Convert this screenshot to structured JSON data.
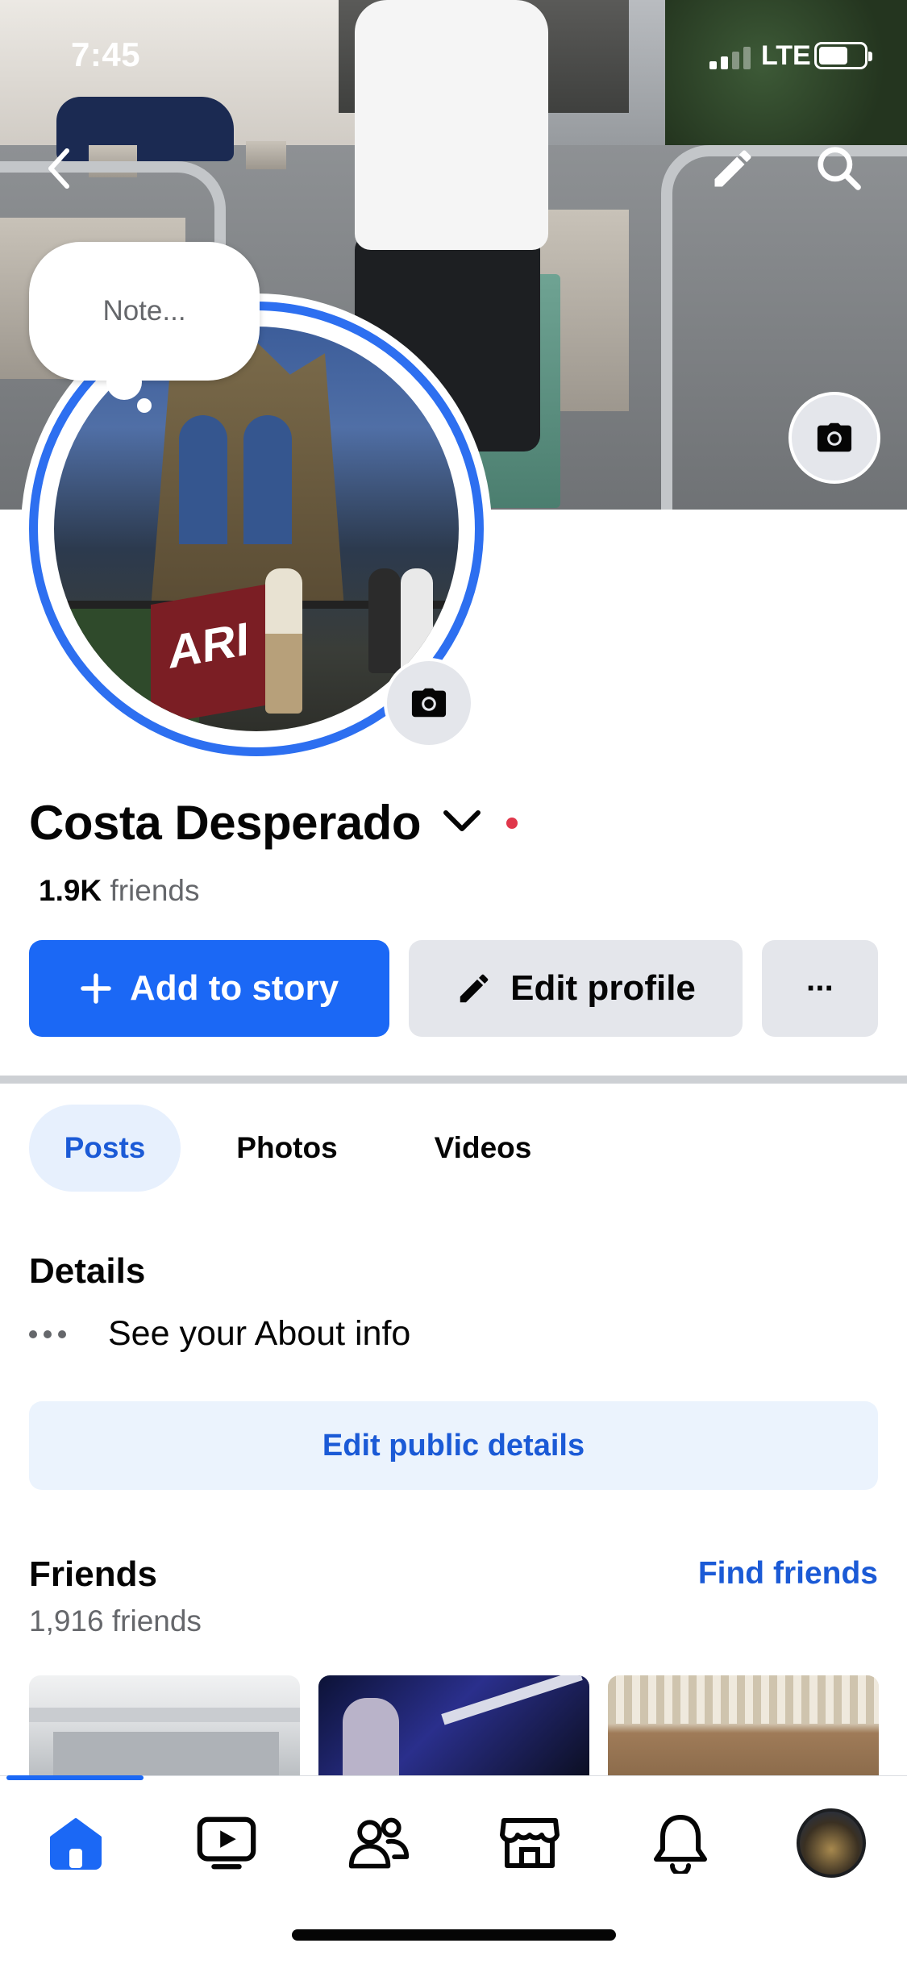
{
  "status_bar": {
    "time": "7:45",
    "network": "LTE",
    "battery_level": 0.65
  },
  "cover": {
    "note_placeholder": "Note..."
  },
  "profile": {
    "name": "Costa Desperado",
    "friends_count": "1.9K",
    "friends_suffix": "friends",
    "online_dot_color": "#e0374b",
    "avatar_banner_text": "ARI"
  },
  "actions": {
    "add_story_label": "Add to story",
    "edit_profile_label": "Edit profile",
    "more_label": "···"
  },
  "tabs": [
    {
      "label": "Posts",
      "active": true
    },
    {
      "label": "Photos",
      "active": false
    },
    {
      "label": "Videos",
      "active": false
    }
  ],
  "details": {
    "title": "Details",
    "about_text": "See your About info",
    "edit_button": "Edit public details"
  },
  "friends": {
    "title": "Friends",
    "find_link": "Find friends",
    "count_text": "1,916 friends"
  },
  "bottom_nav": [
    {
      "name": "home-icon",
      "active": true
    },
    {
      "name": "video-icon",
      "active": false
    },
    {
      "name": "friends-icon",
      "active": false
    },
    {
      "name": "marketplace-icon",
      "active": false
    },
    {
      "name": "bell-icon",
      "active": false
    },
    {
      "name": "profile-avatar",
      "active": false
    }
  ],
  "colors": {
    "accent": "#1b68f5",
    "link": "#1b5ad6",
    "secondary_text": "#65676b",
    "button_grey": "#e4e6eb"
  }
}
